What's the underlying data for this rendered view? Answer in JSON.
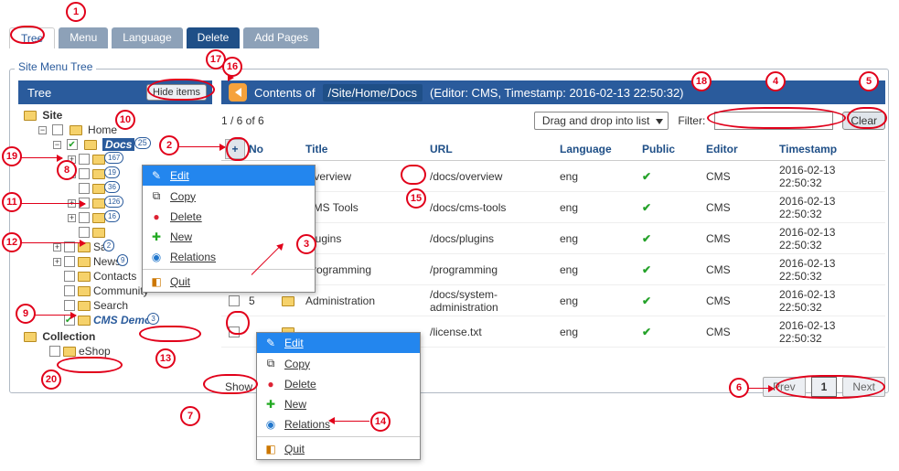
{
  "tabs": {
    "tree": "Tree",
    "menu": "Menu",
    "language": "Language",
    "delete": "Delete",
    "add": "Add Pages"
  },
  "frame_title": "Site Menu Tree",
  "tree_panel_title": "Tree",
  "hide_items": "Hide items",
  "tree": {
    "root1": "Site",
    "home": "Home",
    "docs": "Docs",
    "docs_badge": "25",
    "b_167": "167",
    "b_19": "19",
    "b_36": "36",
    "b_126": "126",
    "b_16": "16",
    "sa": "Sa",
    "sa_badge": "2",
    "news": "News",
    "news_badge": "9",
    "contacts": "Contacts",
    "community": "Community",
    "search": "Search",
    "cms_demo": "CMS Demo",
    "cms_badge": "3",
    "root2": "Collection",
    "eshop": "eShop"
  },
  "content": {
    "contents_of": "Contents of",
    "path": "/Site/Home/Docs",
    "meta": "(Editor: CMS, Timestamp: 2016-02-13 22:50:32)",
    "pager": "1 / 6 of 6",
    "drag": "Drag and drop into list",
    "filter_label": "Filter:",
    "clear": "Clear",
    "show": "Show",
    "prev": "Prev",
    "page": "1",
    "next": "Next"
  },
  "cols": {
    "no": "No",
    "title": "Title",
    "url": "URL",
    "lang": "Language",
    "pub": "Public",
    "ed": "Editor",
    "ts": "Timestamp"
  },
  "rows": [
    {
      "no": "",
      "title": "Overview",
      "url": "/docs/overview",
      "lang": "eng",
      "pub": "✔",
      "ed": "CMS",
      "ts": "2016-02-13 22:50:32"
    },
    {
      "no": "",
      "title": "CMS Tools",
      "url": "/docs/cms-tools",
      "lang": "eng",
      "pub": "✔",
      "ed": "CMS",
      "ts": "2016-02-13 22:50:32"
    },
    {
      "no": "",
      "title": "Plugins",
      "url": "/docs/plugins",
      "lang": "eng",
      "pub": "✔",
      "ed": "CMS",
      "ts": "2016-02-13 22:50:32"
    },
    {
      "no": "",
      "title": "Programming",
      "url": "/programming",
      "lang": "eng",
      "pub": "✔",
      "ed": "CMS",
      "ts": "2016-02-13 22:50:32"
    },
    {
      "no": "5",
      "title": "Administration",
      "url": "/docs/system-administration",
      "lang": "eng",
      "pub": "✔",
      "ed": "CMS",
      "ts": "2016-02-13 22:50:32"
    },
    {
      "no": "",
      "title": "",
      "url": "/license.txt",
      "lang": "eng",
      "pub": "✔",
      "ed": "CMS",
      "ts": "2016-02-13 22:50:32"
    }
  ],
  "ctx": {
    "edit": "Edit",
    "copy": "Copy",
    "delete": "Delete",
    "new": "New",
    "relations": "Relations",
    "quit": "Quit"
  },
  "calls": {
    "1": "1",
    "2": "2",
    "3": "3",
    "4": "4",
    "5": "5",
    "6": "6",
    "7": "7",
    "8": "8",
    "9": "9",
    "10": "10",
    "11": "11",
    "12": "12",
    "13": "13",
    "14": "14",
    "15": "15",
    "16": "16",
    "17": "17",
    "18": "18",
    "19": "19",
    "20": "20"
  }
}
